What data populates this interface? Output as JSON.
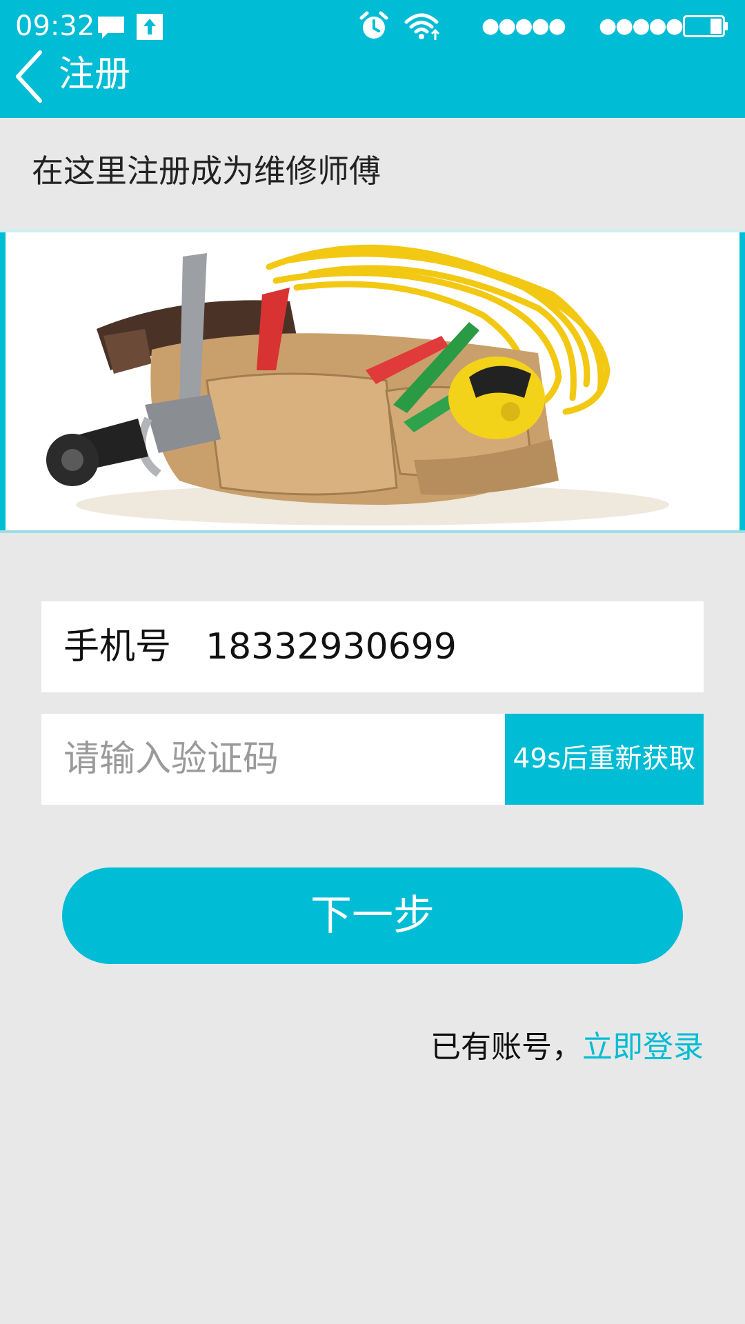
{
  "status_bar": {
    "time": "09:32",
    "icons": [
      "message-icon",
      "upload-icon",
      "alarm-icon",
      "wifi-icon",
      "signal-icon",
      "signal-icon",
      "battery-icon"
    ],
    "signal_dots": "●●●●●"
  },
  "header": {
    "title": "注册",
    "back_icon": "chevron-left-icon"
  },
  "intro": "在这里注册成为维修师傅",
  "banner": {
    "image": "tool-belt-with-tools-illustration"
  },
  "form": {
    "phone_label": "手机号",
    "phone_value": "18332930699",
    "code_placeholder": "请输入验证码",
    "resend_label": "49s后重新获取"
  },
  "next_button": "下一步",
  "login": {
    "prompt": "已有账号，",
    "link": "立即登录"
  },
  "colors": {
    "accent": "#00bcd4",
    "background": "#e8e8e8"
  }
}
